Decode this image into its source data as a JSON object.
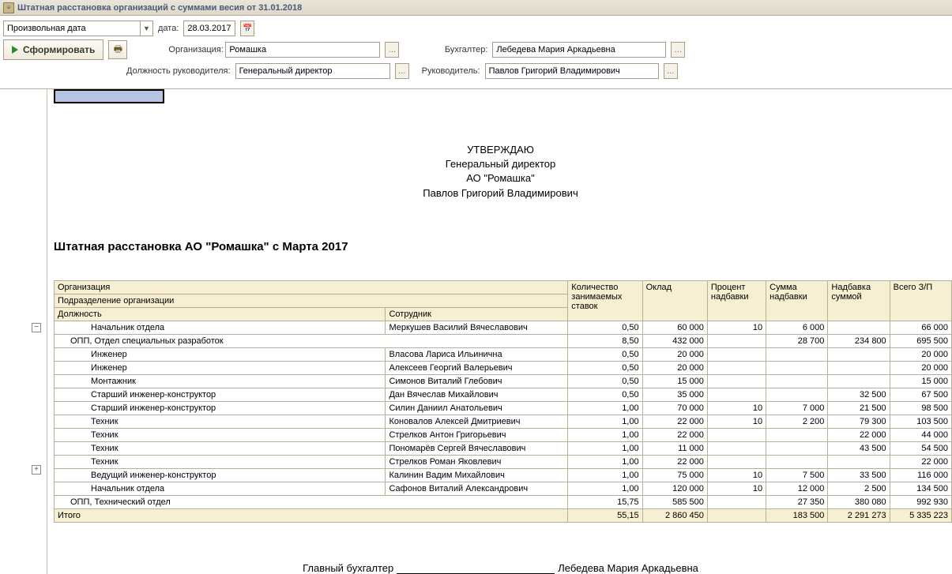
{
  "titlebar": {
    "text": "Штатная расстановка организаций с суммами весия от 31.01.2018"
  },
  "toolbar": {
    "date_mode": "Произвольная дата",
    "date_label": "дата:",
    "date_value": "28.03.2017",
    "form_button": "Сформировать",
    "org_label": "Организация:",
    "org_value": "Ромашка",
    "buh_label": "Бухгалтер:",
    "buh_value": "Лебедева Мария Аркадьевна",
    "pos_label": "Должность руководителя:",
    "pos_value": "Генеральный директор",
    "head_label": "Руководитель:",
    "head_value": "Павлов Григорий Владимирович"
  },
  "approve": {
    "line1": "УТВЕРЖДАЮ",
    "line2": "Генеральный директор",
    "line3": "АО \"Ромашка\"",
    "line4": "Павлов Григорий Владимирович"
  },
  "report_title": "Штатная расстановка АО \"Ромашка\" с Марта 2017",
  "headers": {
    "org": "Организация",
    "dept": "Подразделение организации",
    "position": "Должность",
    "employee": "Сотрудник",
    "qty": "Количество занимаемых ставок",
    "oklad": "Оклад",
    "pct": "Процент надбавки",
    "sum": "Сумма надбавки",
    "nad": "Надбавка суммой",
    "total": "Всего З/П",
    "itogo": "Итого"
  },
  "rows": [
    {
      "lvl": 2,
      "name": "Начальник отдела",
      "emp": "Меркушев Василий Вячеславович",
      "qty": "0,50",
      "oklad": "60 000",
      "pct": "10",
      "sum": "6 000",
      "nad": "",
      "total": "66 000"
    },
    {
      "lvl": 1,
      "name": "ОПП, Отдел специальных разработок",
      "emp": "",
      "qty": "8,50",
      "oklad": "432 000",
      "pct": "",
      "sum": "28 700",
      "nad": "234 800",
      "total": "695 500"
    },
    {
      "lvl": 2,
      "name": "Инженер",
      "emp": "Власова Лариса Ильинична",
      "qty": "0,50",
      "oklad": "20 000",
      "pct": "",
      "sum": "",
      "nad": "",
      "total": "20 000"
    },
    {
      "lvl": 2,
      "name": "Инженер",
      "emp": "Алексеев Георгий Валерьевич",
      "qty": "0,50",
      "oklad": "20 000",
      "pct": "",
      "sum": "",
      "nad": "",
      "total": "20 000"
    },
    {
      "lvl": 2,
      "name": "Монтажник",
      "emp": "Симонов Виталий Глебович",
      "qty": "0,50",
      "oklad": "15 000",
      "pct": "",
      "sum": "",
      "nad": "",
      "total": "15 000"
    },
    {
      "lvl": 2,
      "name": "Старший инженер-конструктор",
      "emp": "Дан Вячеслав Михайлович",
      "qty": "0,50",
      "oklad": "35 000",
      "pct": "",
      "sum": "",
      "nad": "32 500",
      "total": "67 500"
    },
    {
      "lvl": 2,
      "name": "Старший инженер-конструктор",
      "emp": "Силин Даниил Анатольевич",
      "qty": "1,00",
      "oklad": "70 000",
      "pct": "10",
      "sum": "7 000",
      "nad": "21 500",
      "total": "98 500"
    },
    {
      "lvl": 2,
      "name": "Техник",
      "emp": "Коновалов Алексей Дмитриевич",
      "qty": "1,00",
      "oklad": "22 000",
      "pct": "10",
      "sum": "2 200",
      "nad": "79 300",
      "total": "103 500"
    },
    {
      "lvl": 2,
      "name": "Техник",
      "emp": "Стрелков Антон Григорьевич",
      "qty": "1,00",
      "oklad": "22 000",
      "pct": "",
      "sum": "",
      "nad": "22 000",
      "total": "44 000"
    },
    {
      "lvl": 2,
      "name": "Техник",
      "emp": "Пономарёв Сергей Вячеславович",
      "qty": "1,00",
      "oklad": "11 000",
      "pct": "",
      "sum": "",
      "nad": "43 500",
      "total": "54 500"
    },
    {
      "lvl": 2,
      "name": "Техник",
      "emp": "Стрелков Роман Яковлевич",
      "qty": "1,00",
      "oklad": "22 000",
      "pct": "",
      "sum": "",
      "nad": "",
      "total": "22 000"
    },
    {
      "lvl": 2,
      "name": "Ведущий инженер-конструктор",
      "emp": "Калинин Вадим Михайлович",
      "qty": "1,00",
      "oklad": "75 000",
      "pct": "10",
      "sum": "7 500",
      "nad": "33 500",
      "total": "116 000"
    },
    {
      "lvl": 2,
      "name": "Начальник отдела",
      "emp": "Сафонов Виталий Александрович",
      "qty": "1,00",
      "oklad": "120 000",
      "pct": "10",
      "sum": "12 000",
      "nad": "2 500",
      "total": "134 500"
    },
    {
      "lvl": 1,
      "name": "ОПП, Технический отдел",
      "emp": "",
      "qty": "15,75",
      "oklad": "585 500",
      "pct": "",
      "sum": "27 350",
      "nad": "380 080",
      "total": "992 930"
    }
  ],
  "totals": {
    "qty": "55,15",
    "oklad": "2 860 450",
    "pct": "",
    "sum": "183 500",
    "nad": "2 291 273",
    "total": "5 335 223"
  },
  "footer": {
    "label": "Главный бухгалтер",
    "name": "Лебедева Мария Аркадьевна"
  }
}
